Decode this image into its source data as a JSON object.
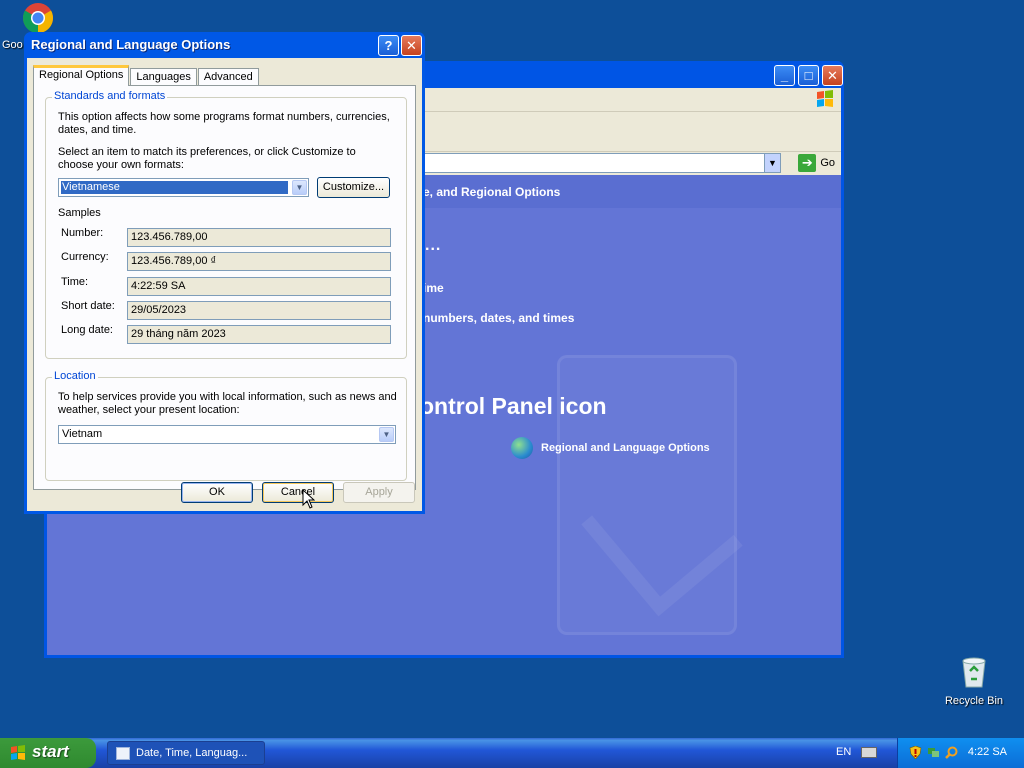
{
  "desktop": {
    "icons": [
      {
        "label": "Goo",
        "icon": "chrome-icon"
      },
      {
        "label": "Recycle Bin",
        "icon": "recycle-bin-icon"
      }
    ]
  },
  "control_panel": {
    "address_go": "Go",
    "header_text": "e, and Regional Options",
    "task_ellipsis": "...",
    "task_1": "ime",
    "task_2": "numbers, dates, and times",
    "icon_heading": "ontrol Panel icon",
    "icon_item_label": "Regional and Language Options"
  },
  "dialog": {
    "title": "Regional and Language Options",
    "tabs": [
      "Regional Options",
      "Languages",
      "Advanced"
    ],
    "standards": {
      "legend": "Standards and formats",
      "description": "This option affects how some programs format numbers, currencies, dates, and time.",
      "select_prompt": "Select an item to match its preferences, or click Customize to choose your own formats:",
      "selected_locale": "Vietnamese",
      "customize_label": "Customize..."
    },
    "samples": {
      "heading": "Samples",
      "rows": [
        {
          "label": "Number:",
          "value": "123.456.789,00"
        },
        {
          "label": "Currency:",
          "value": "123.456.789,00 ₫"
        },
        {
          "label": "Time:",
          "value": "4:22:59 SA"
        },
        {
          "label": "Short date:",
          "value": "29/05/2023"
        },
        {
          "label": "Long date:",
          "value": "29 tháng năm 2023"
        }
      ]
    },
    "location": {
      "legend": "Location",
      "description": "To help services provide you with local information, such as news and weather, select your present location:",
      "selected": "Vietnam"
    },
    "buttons": {
      "ok": "OK",
      "cancel": "Cancel",
      "apply": "Apply"
    }
  },
  "taskbar": {
    "start_label": "start",
    "task_label": "Date, Time, Languag...",
    "language": "EN",
    "clock": "4:22 SA"
  }
}
